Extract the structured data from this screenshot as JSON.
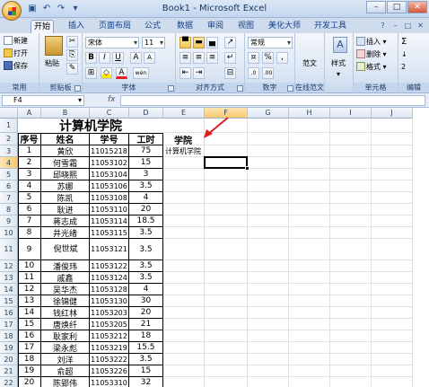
{
  "window": {
    "title": "Book1 - Microsoft Excel",
    "minimize": "–",
    "maximize": "□",
    "close": "✕"
  },
  "tabs": [
    "开始",
    "插入",
    "页面布局",
    "公式",
    "数据",
    "审阅",
    "视图",
    "美化大师",
    "开发工具"
  ],
  "active_tab": "开始",
  "ribbon": {
    "clipboard": {
      "new": "新建",
      "open": "打开",
      "save": "保存",
      "paste": "粘贴",
      "label": "剪贴板"
    },
    "common_label": "常用",
    "font": {
      "name": "宋体",
      "size": "11",
      "label": "字体",
      "bold": "B",
      "italic": "I",
      "underline": "U",
      "grow": "A",
      "shrink": "A",
      "color": "A",
      "wen": "wén"
    },
    "alignment": {
      "label": "对齐方式"
    },
    "number": {
      "format": "常规",
      "percent": "%",
      "comma": ",",
      "label": "数字"
    },
    "fanwen": "范文",
    "online_label": "在线范文",
    "styles": "样式",
    "cells": {
      "insert": "插入",
      "delete": "删除",
      "format": "格式",
      "label": "单元格"
    },
    "editing": {
      "sum": "Σ",
      "fill": "↓",
      "clear": "2",
      "label": "编辑"
    }
  },
  "formula_bar": {
    "name_box": "F4",
    "fx": "fx",
    "value": ""
  },
  "columns": [
    "A",
    "B",
    "C",
    "D",
    "E",
    "F",
    "G",
    "H",
    "I",
    "J"
  ],
  "selected_column": "F",
  "selected_row": "4",
  "sheet": {
    "title": "计算机学院",
    "headers": [
      "序号",
      "姓名",
      "学号",
      "工时"
    ],
    "e2": "学院",
    "e3": "计算机学院",
    "rows": [
      [
        "1",
        "黄欣",
        "11015218",
        "75"
      ],
      [
        "2",
        "何雪霜",
        "11053102",
        "15"
      ],
      [
        "3",
        "邱晓熙",
        "11053104",
        "3"
      ],
      [
        "4",
        "苏娜",
        "11053106",
        "3.5"
      ],
      [
        "5",
        "陈凯",
        "11053108",
        "4"
      ],
      [
        "6",
        "耿进",
        "11053110",
        "20"
      ],
      [
        "7",
        "蒋志成",
        "11053114",
        "18.5"
      ],
      [
        "8",
        "井光绪",
        "11053115",
        "3.5"
      ],
      [
        "9",
        "倪世斌",
        "11053121",
        "3.5"
      ],
      [
        "10",
        "潘俊玮",
        "11053122",
        "3.5"
      ],
      [
        "11",
        "戚鑫",
        "11053124",
        "3.5"
      ],
      [
        "12",
        "吴华杰",
        "11053128",
        "4"
      ],
      [
        "13",
        "徐锦健",
        "11053130",
        "30"
      ],
      [
        "14",
        "钱红林",
        "11053203",
        "20"
      ],
      [
        "15",
        "唐焕纤",
        "11053205",
        "21"
      ],
      [
        "16",
        "耿家利",
        "11053212",
        "18"
      ],
      [
        "17",
        "梁永彪",
        "11053219",
        "15.5"
      ],
      [
        "18",
        "刘洋",
        "11053222",
        "3.5"
      ],
      [
        "19",
        "俞超",
        "11053226",
        "15"
      ],
      [
        "20",
        "陈郢伟",
        "11053310",
        "32"
      ]
    ],
    "row_numbers": [
      "1",
      "2",
      "3",
      "4",
      "5",
      "6",
      "7",
      "8",
      "9",
      "10",
      "11",
      "12",
      "13",
      "14",
      "15",
      "16",
      "17",
      "18",
      "19",
      "20",
      "21",
      "22"
    ]
  },
  "colors": {
    "annotation_arrow": "#e0201c",
    "selected_header": "#f8c86d"
  }
}
